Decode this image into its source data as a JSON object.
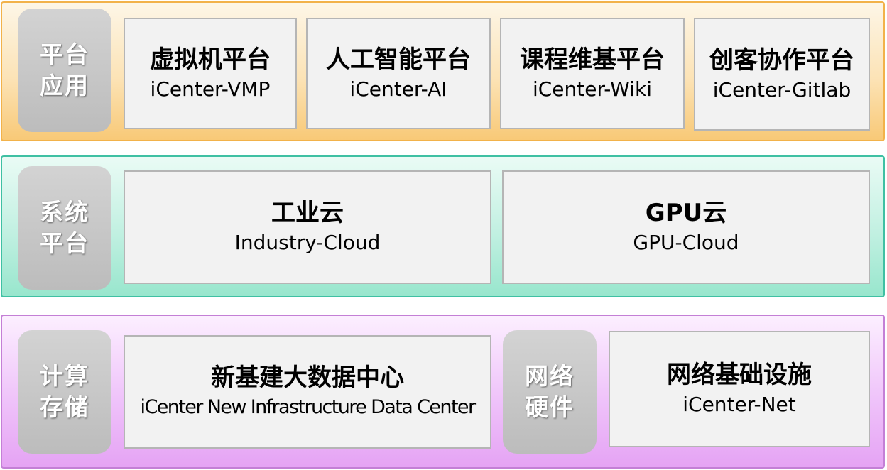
{
  "layers": {
    "application": {
      "label": "平台应用",
      "items": [
        {
          "title": "虚拟机平台",
          "subtitle": "iCenter-VMP"
        },
        {
          "title": "人工智能平台",
          "subtitle": "iCenter-AI"
        },
        {
          "title": "课程维基平台",
          "subtitle": "iCenter-Wiki"
        },
        {
          "title": "创客协作平台",
          "subtitle": "iCenter-Gitlab"
        }
      ]
    },
    "system": {
      "label": "系统平台",
      "items": [
        {
          "title": "工业云",
          "subtitle": "Industry-Cloud"
        },
        {
          "title": "GPU云",
          "subtitle": "GPU-Cloud"
        }
      ]
    },
    "compute": {
      "label": "计算存储",
      "items": [
        {
          "title": "新基建大数据中心",
          "subtitle": "iCenter New Infrastructure Data Center"
        }
      ],
      "network_label": "网络硬件",
      "network_items": [
        {
          "title": "网络基础设施",
          "subtitle": "iCenter-Net"
        }
      ]
    }
  },
  "colors": {
    "application_band": "#f8c977",
    "system_band": "#98e6cd",
    "compute_band": "#e5a3f4",
    "tag_gray": "#bcbcbc",
    "box_fill": "#f2f2f2"
  }
}
